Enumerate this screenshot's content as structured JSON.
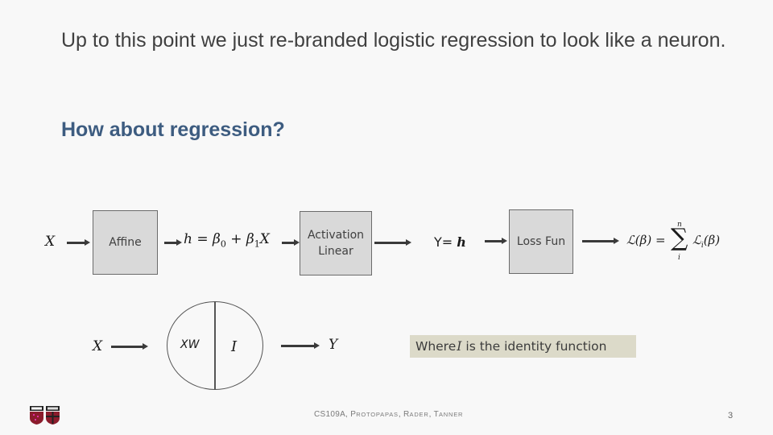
{
  "slide": {
    "intro_text": "Up to this point we just re-branded logistic regression to look like a neuron.",
    "subheading": "How about regression?"
  },
  "pipeline": {
    "input_label": "X",
    "affine_box": "Affine",
    "affine_formula": {
      "lhs": "h",
      "eq": " = ",
      "b0": "β",
      "b0_sub": "0",
      "plus": " + ",
      "b1": "β",
      "b1_sub": "1",
      "x": "X"
    },
    "activation_box_line1": "Activation",
    "activation_box_line2": "Linear",
    "output_prefix": "Y= ",
    "output_var": "h",
    "loss_box": "Loss Fun",
    "loss_formula": {
      "lhs": "ℒ(β) = ",
      "sum_symbol": "∑",
      "sum_upper": "n",
      "sum_lower": "i",
      "term": "ℒ",
      "term_sub": "i",
      "term_arg": "(β)"
    }
  },
  "neuron": {
    "input_label": "X",
    "left_half": "XW",
    "right_half": "I",
    "output_label": "Y"
  },
  "note": {
    "prefix": "Where ",
    "symbol": "I",
    "suffix": " is the identity function"
  },
  "footer": {
    "course": "CS109A, ",
    "authors": [
      {
        "initial": "P",
        "rest": "ROTOPAPAS"
      },
      {
        "initial": "R",
        "rest": "ADER"
      },
      {
        "initial": "T",
        "rest": "ANNER"
      }
    ],
    "page_number": "3"
  },
  "logos": [
    "iacs-shield-logo",
    "harvard-seas-shield-logo"
  ],
  "colors": {
    "heading_blue": "#3d5c80",
    "box_gray": "#d9d9d9",
    "note_bg": "#dcdac9",
    "background": "#f8f8f8"
  }
}
